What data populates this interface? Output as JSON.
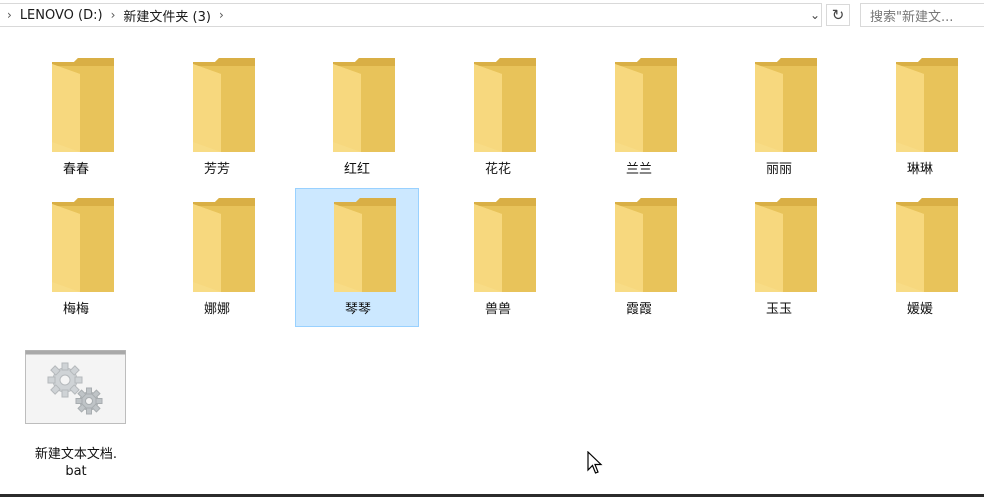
{
  "breadcrumb": {
    "items": [
      "LENOVO (D:)",
      "新建文件夹 (3)"
    ],
    "sep": "›"
  },
  "address_controls": {
    "dropdown_glyph": "⌄",
    "refresh_glyph": "↻"
  },
  "search": {
    "placeholder": "搜索\"新建文..."
  },
  "folders_row1": [
    {
      "name": "春春"
    },
    {
      "name": "芳芳"
    },
    {
      "name": "红红"
    },
    {
      "name": "花花"
    },
    {
      "name": "兰兰"
    },
    {
      "name": "丽丽"
    },
    {
      "name": "琳琳"
    }
  ],
  "folders_row2": [
    {
      "name": "梅梅"
    },
    {
      "name": "娜娜"
    },
    {
      "name": "琴琴"
    },
    {
      "name": "兽兽"
    },
    {
      "name": "霞霞"
    },
    {
      "name": "玉玉"
    },
    {
      "name": "媛媛"
    }
  ],
  "file": {
    "name_line1": "新建文本文档.",
    "name_line2": "bat",
    "icon": "gears-icon"
  },
  "selected_folder": "琴琴",
  "colors": {
    "folder_back": "#e8c35a",
    "folder_front": "#f8dc86",
    "selection_bg": "#cce8ff",
    "selection_border": "#99d1ff"
  }
}
